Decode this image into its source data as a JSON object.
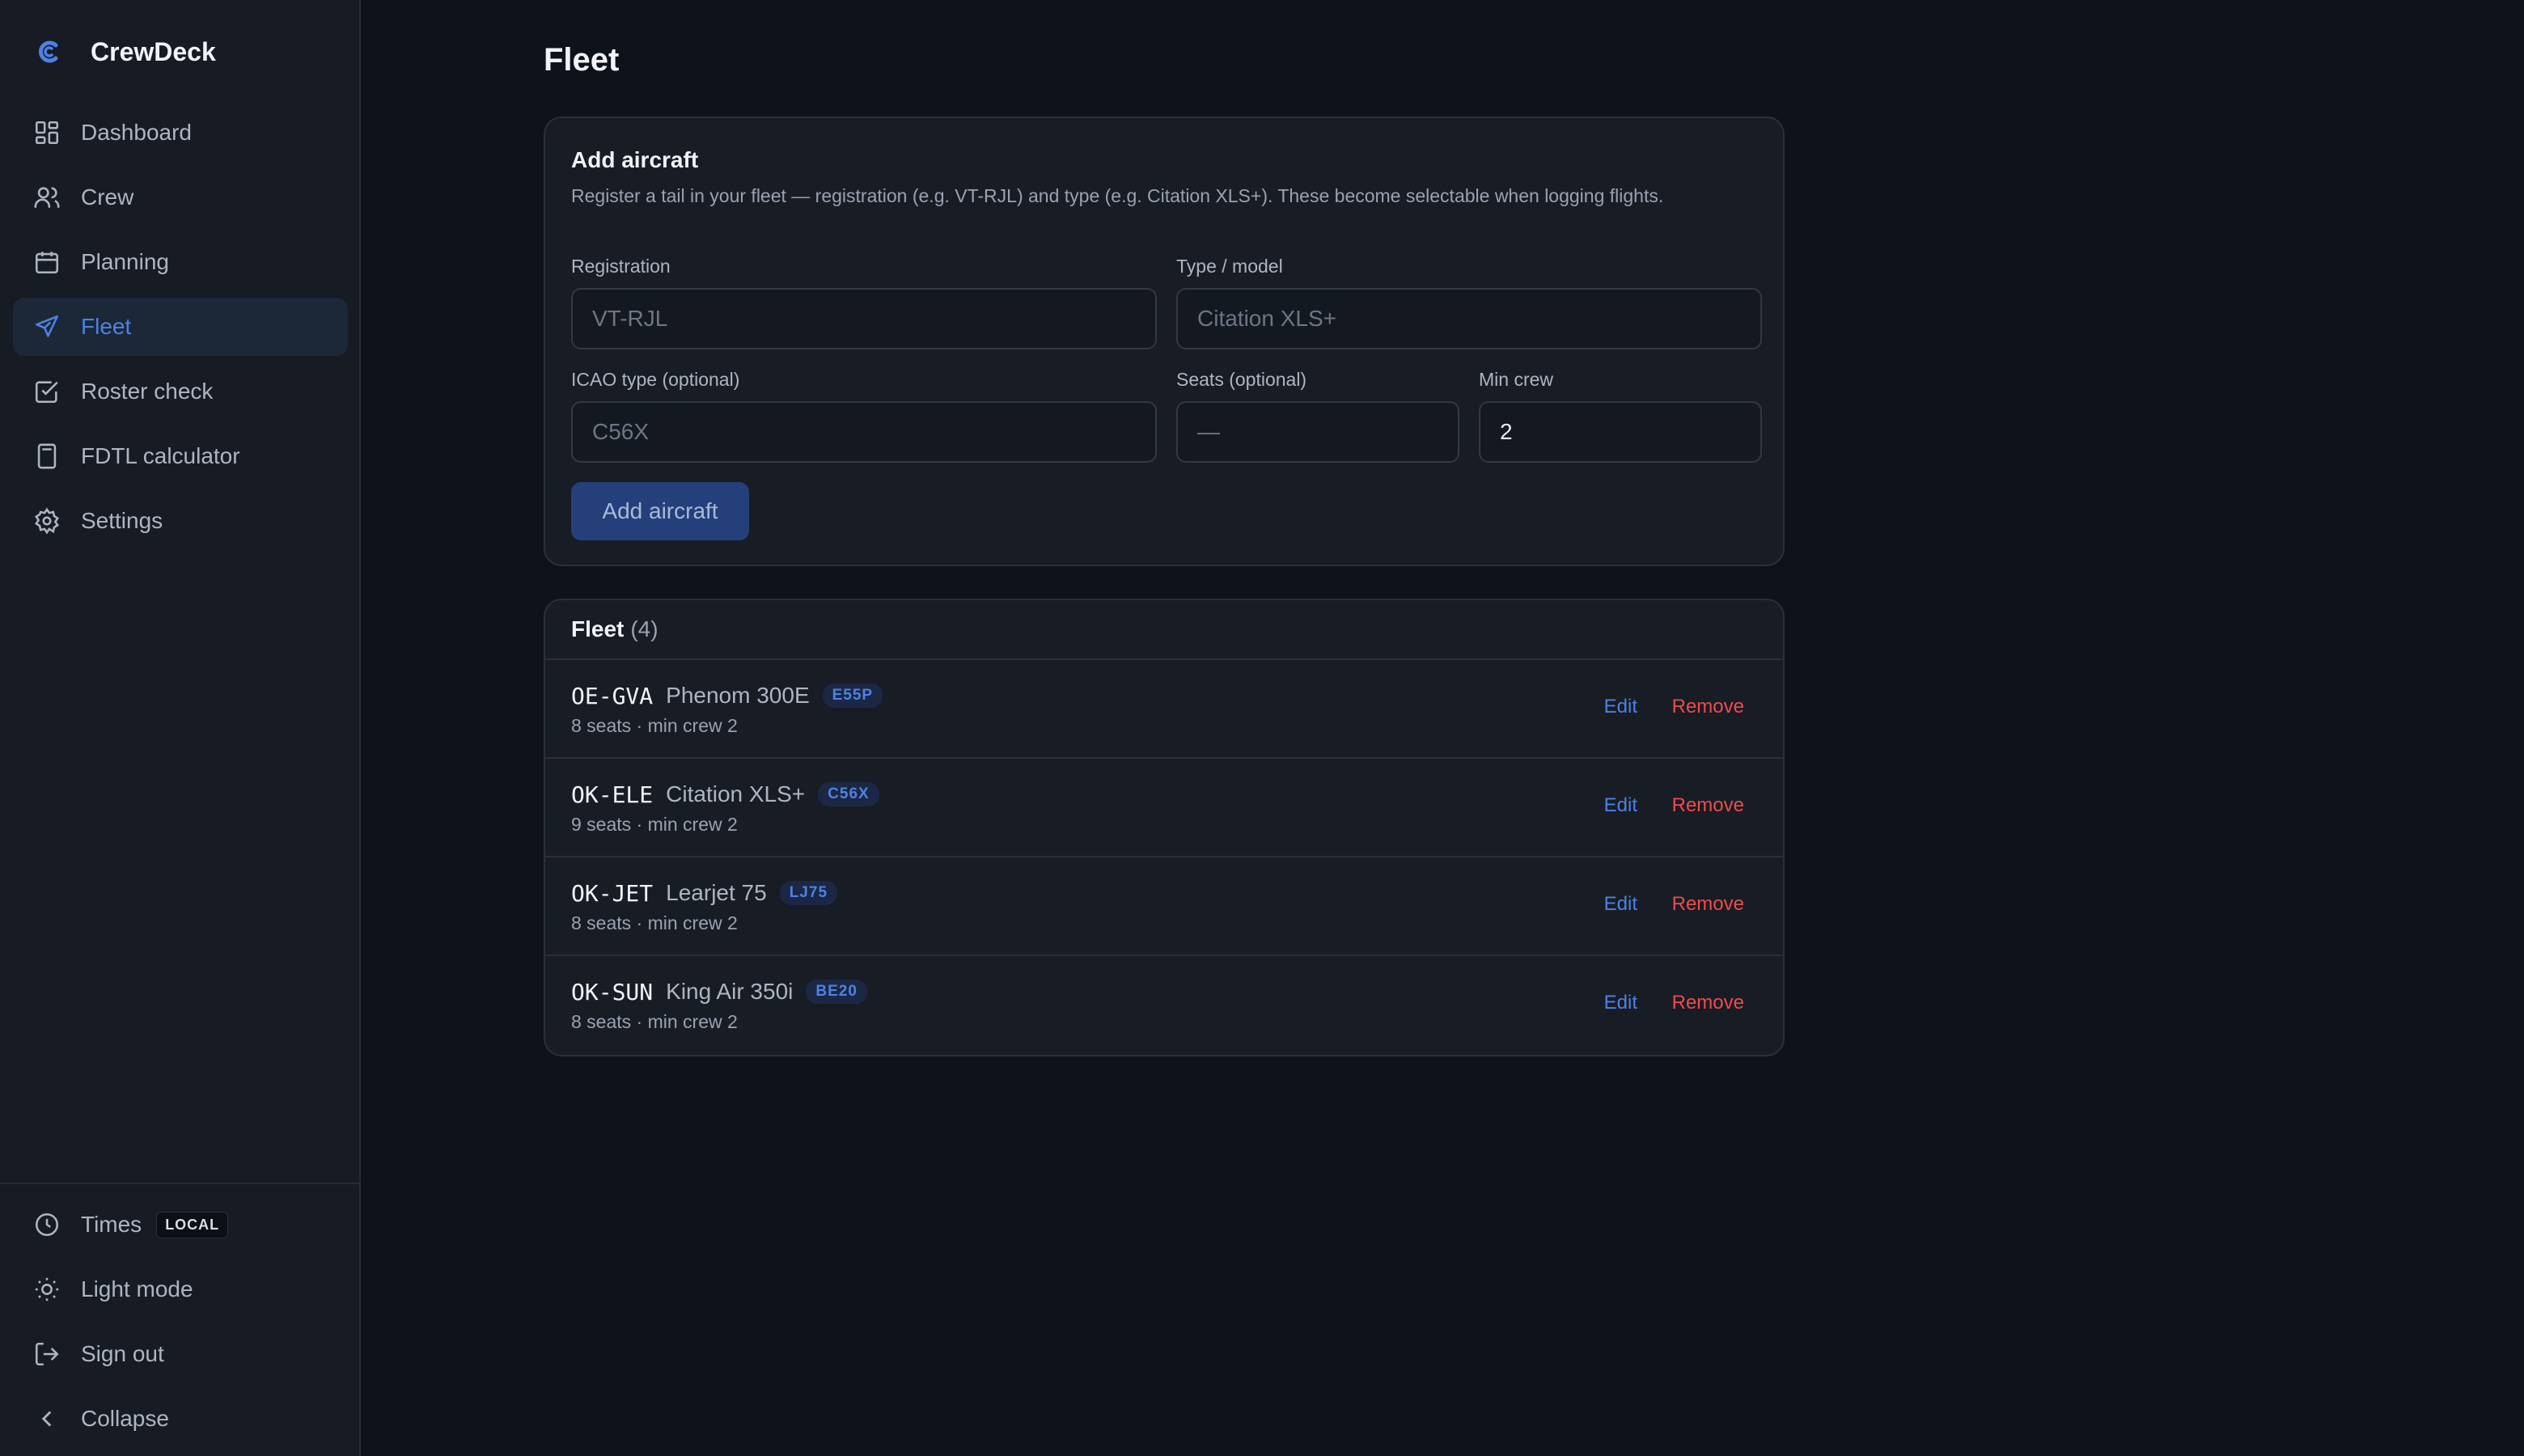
{
  "app": {
    "name": "CrewDeck"
  },
  "colors": {
    "accent": "#4d82e2",
    "danger": "#ef4b4b",
    "background": "#0e121a",
    "sidebar": "#171b24"
  },
  "sidebar": {
    "items": [
      {
        "label": "Dashboard",
        "icon": "dashboard-icon",
        "active": false
      },
      {
        "label": "Crew",
        "icon": "users-icon",
        "active": false
      },
      {
        "label": "Planning",
        "icon": "calendar-icon",
        "active": false
      },
      {
        "label": "Fleet",
        "icon": "plane-icon",
        "active": true
      },
      {
        "label": "Roster check",
        "icon": "checkbox-icon",
        "active": false
      },
      {
        "label": "FDTL calculator",
        "icon": "calculator-icon",
        "active": false
      },
      {
        "label": "Settings",
        "icon": "gear-icon",
        "active": false
      }
    ],
    "bottom": {
      "times_label": "Times",
      "times_badge": "LOCAL",
      "light_mode": "Light mode",
      "sign_out": "Sign out",
      "collapse": "Collapse"
    }
  },
  "page": {
    "title": "Fleet"
  },
  "add_form": {
    "title": "Add aircraft",
    "description": "Register a tail in your fleet — registration (e.g. VT-RJL) and type (e.g. Citation XLS+). These become selectable when logging flights.",
    "registration": {
      "label": "Registration",
      "placeholder": "VT-RJL",
      "value": ""
    },
    "type_model": {
      "label": "Type / model",
      "placeholder": "Citation XLS+",
      "value": ""
    },
    "icao_type": {
      "label": "ICAO type (optional)",
      "placeholder": "C56X",
      "value": ""
    },
    "seats": {
      "label": "Seats (optional)",
      "placeholder": "—",
      "value": ""
    },
    "min_crew": {
      "label": "Min crew",
      "placeholder": "",
      "value": "2"
    },
    "submit_label": "Add aircraft"
  },
  "fleet": {
    "title": "Fleet",
    "count": "(4)",
    "edit_label": "Edit",
    "remove_label": "Remove",
    "aircraft": [
      {
        "registration": "OE-GVA",
        "type": "Phenom 300E",
        "icao": "E55P",
        "details": "8 seats · min crew 2"
      },
      {
        "registration": "OK-ELE",
        "type": "Citation XLS+",
        "icao": "C56X",
        "details": "9 seats · min crew 2"
      },
      {
        "registration": "OK-JET",
        "type": "Learjet 75",
        "icao": "LJ75",
        "details": "8 seats · min crew 2"
      },
      {
        "registration": "OK-SUN",
        "type": "King Air 350i",
        "icao": "BE20",
        "details": "8 seats · min crew 2"
      }
    ]
  }
}
